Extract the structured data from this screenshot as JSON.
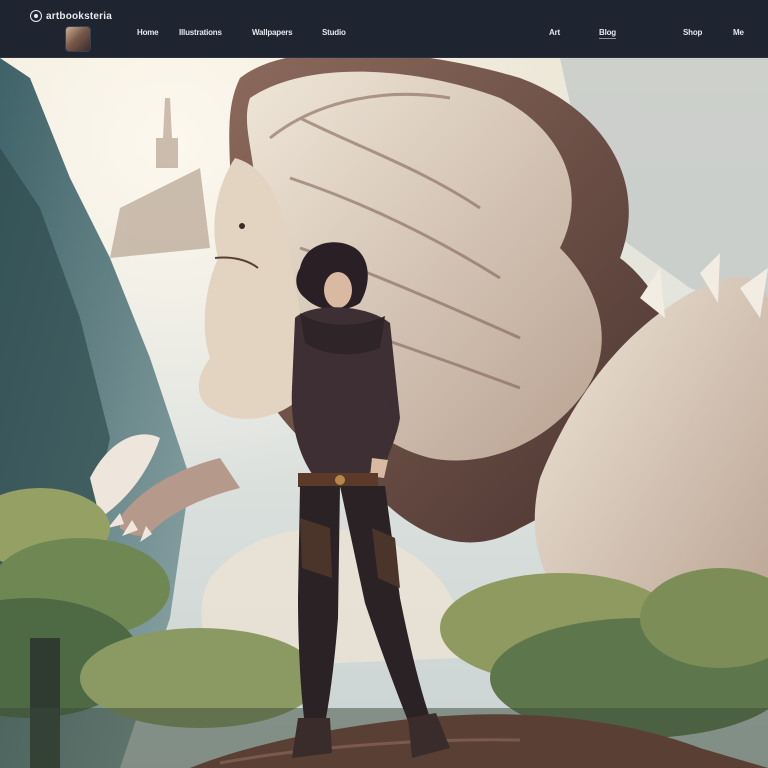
{
  "header": {
    "brand": "artbooksteria",
    "nav": [
      {
        "label": "Home"
      },
      {
        "label": "Illustrations"
      },
      {
        "label": "Wallpapers"
      },
      {
        "label": "Studio"
      }
    ],
    "right_nav": [
      {
        "label": "Art"
      },
      {
        "label": "Blog"
      },
      {
        "label": "Shop"
      },
      {
        "label": "Me"
      }
    ]
  },
  "hero": {
    "icon": "fantasy-artwork"
  },
  "colors": {
    "topbar": "#1f2431",
    "sky": "#e9e2d3",
    "creature_fur": "#e8dccb",
    "rock": "#5a3f34"
  }
}
